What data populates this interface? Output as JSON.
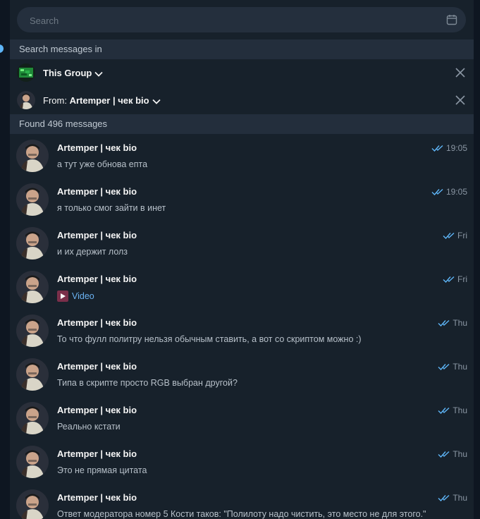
{
  "search": {
    "placeholder": "Search"
  },
  "sections": {
    "search_in": "Search messages in",
    "found": "Found 496 messages"
  },
  "filters": {
    "chat": {
      "label": "This Group"
    },
    "from": {
      "prefix": "From: ",
      "name": "Artemper | чек bio"
    }
  },
  "messages": [
    {
      "name": "Artemper | чек bio",
      "text": "а тут уже обнова епта",
      "time": "19:05"
    },
    {
      "name": "Artemper | чек bio",
      "text": "я только смог зайти в инет",
      "time": "19:05"
    },
    {
      "name": "Artemper | чек bio",
      "text": "и их держит лолз",
      "time": "Fri"
    },
    {
      "name": "Artemper | чек bio",
      "text": "Video",
      "time": "Fri",
      "media": "video"
    },
    {
      "name": "Artemper | чек bio",
      "text": "То что фулл политру нельзя обычным ставить, а вот со скриптом можно :)",
      "time": "Thu"
    },
    {
      "name": "Artemper | чек bio",
      "text": "Типа в скрипте просто RGB выбран другой?",
      "time": "Thu"
    },
    {
      "name": "Artemper | чек bio",
      "text": "Реально кстати",
      "time": "Thu"
    },
    {
      "name": "Artemper | чек bio",
      "text": "Это не прямая цитата",
      "time": "Thu"
    },
    {
      "name": "Artemper | чек bio",
      "text": "Ответ модератора номер 5 Кости таков: \"Полилоту надо чистить, это место не для этого.\"",
      "time": "Thu"
    }
  ],
  "icons": {
    "calendar": "calendar-icon",
    "close": "close-icon",
    "chevron": "chevron-down-icon",
    "read": "double-check-icon",
    "video": "video-icon"
  },
  "colors": {
    "background": "#17212b",
    "header": "#232e3c",
    "accent": "#5eb5f7",
    "link": "#6ab2f2",
    "muted_text": "#b7c0c9"
  }
}
